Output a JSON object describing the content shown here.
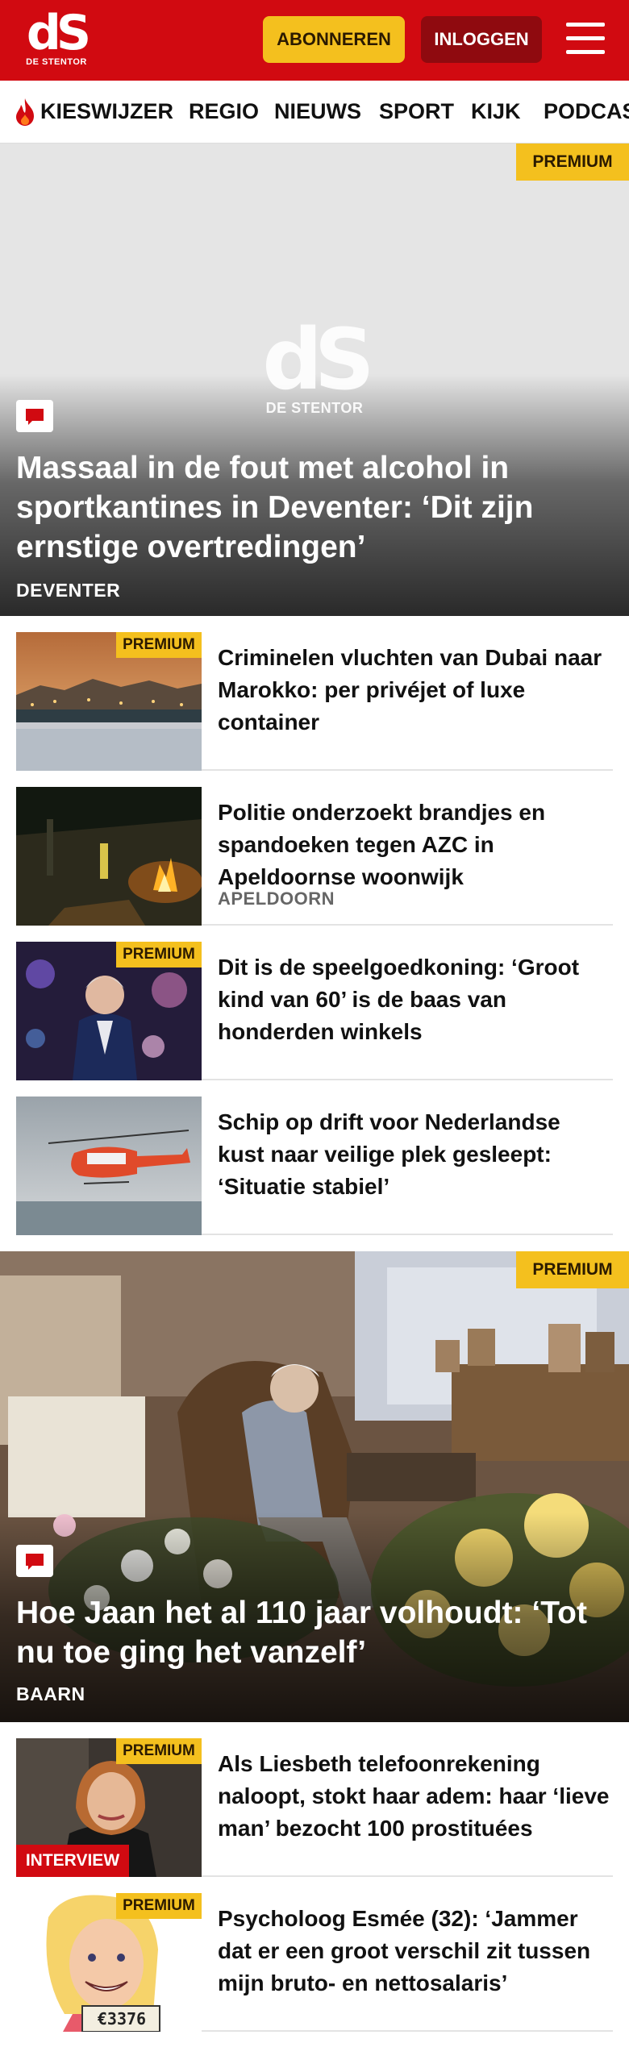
{
  "header": {
    "logo_text": "dS",
    "logo_subtext": "DE STENTOR",
    "subscribe_label": "ABONNEREN",
    "login_label": "INLOGGEN",
    "brand_color": "#d10a11",
    "accent_color": "#f4c01e"
  },
  "nav": {
    "items": [
      "KIESWIJZER",
      "REGIO",
      "NIEUWS",
      "SPORT",
      "KIJK",
      "PODCAS"
    ]
  },
  "hero1": {
    "badge": "PREMIUM",
    "title": "Massaal in de fout met alcohol in sportkantines in Deventer: ‘Dit zijn ernstige overtredingen’",
    "category": "DEVENTER",
    "placeholder_logo": "dS",
    "placeholder_sub": "DE STENTOR"
  },
  "articles": [
    {
      "badge": "PREMIUM",
      "title": "Criminelen vluchten van Dubai naar Marokko: per privéjet of luxe container",
      "category": ""
    },
    {
      "badge": "",
      "title": "Politie onderzoekt brandjes en spandoeken tegen AZC in Apeldoornse woonwijk",
      "category": "APELDOORN"
    },
    {
      "badge": "PREMIUM",
      "title": "Dit is de speelgoedkoning: ‘Groot kind van 60’ is de baas van honderden winkels",
      "category": ""
    },
    {
      "badge": "",
      "title": "Schip op drift voor Nederlandse kust naar veilige plek gesleept: ‘Situatie stabiel’",
      "category": ""
    }
  ],
  "hero2": {
    "badge": "PREMIUM",
    "title": "Hoe Jaan het al 110 jaar volhoudt: ‘Tot nu toe ging het vanzelf’",
    "category": "BAARN"
  },
  "articles2": [
    {
      "badge": "PREMIUM",
      "label": "INTERVIEW",
      "title": "Als Liesbeth telefoonrekening naloopt, stokt haar adem: haar ‘lieve man’ bezocht 100 prostituées"
    },
    {
      "badge": "PREMIUM",
      "label": "",
      "title": "Psycholoog Esmée (32): ‘Jammer dat er een groot verschil zit tussen mijn bruto- en nettosalaris’",
      "thumb_text": "€3376"
    }
  ]
}
